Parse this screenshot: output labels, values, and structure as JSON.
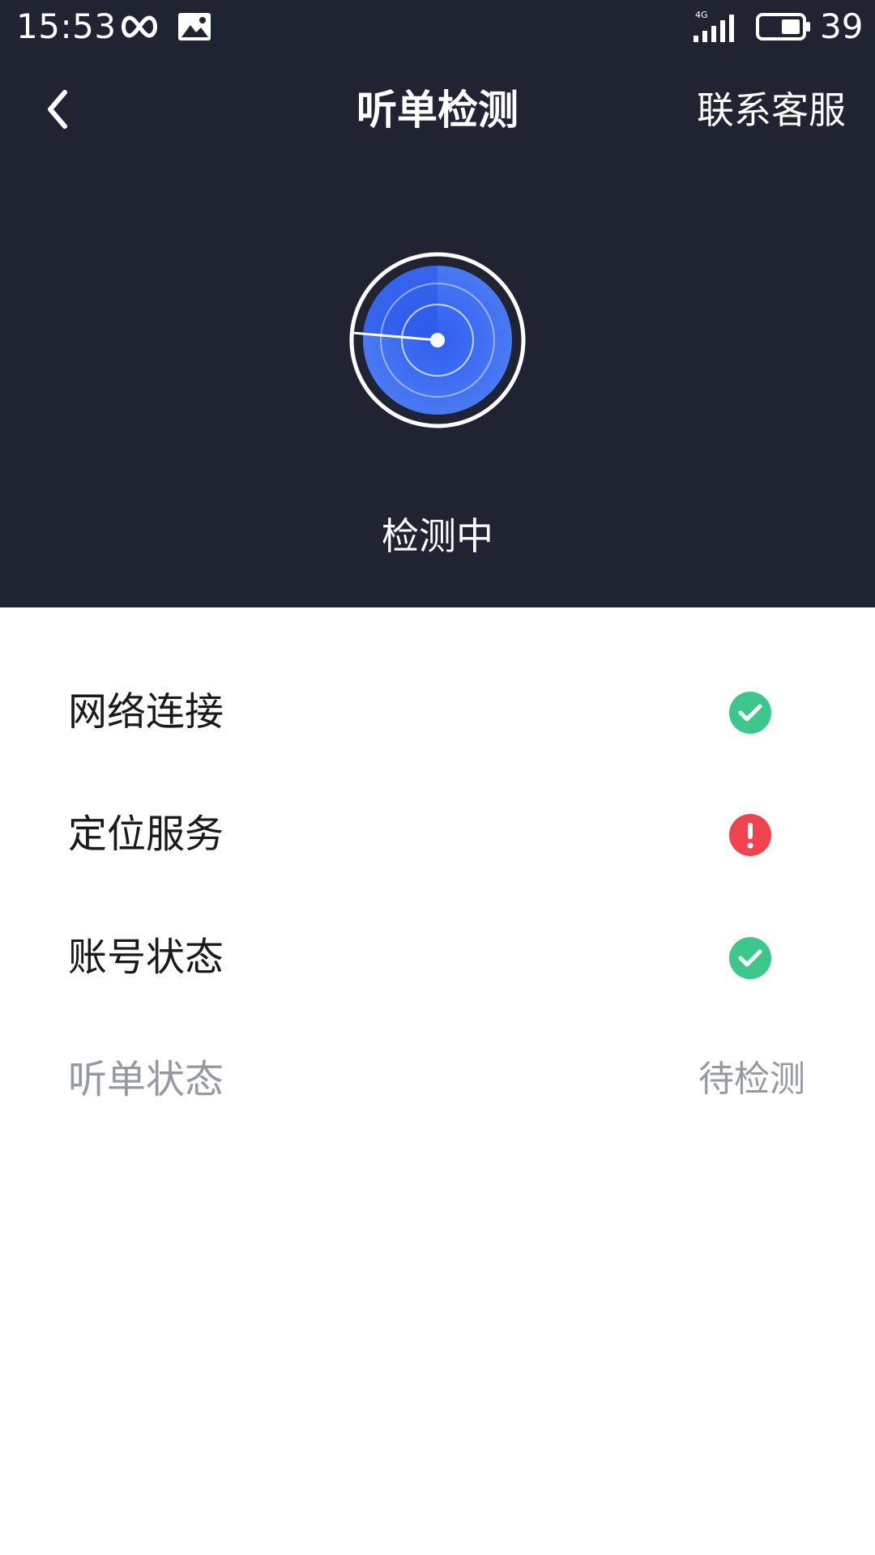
{
  "status_bar": {
    "time": "15:53",
    "network": "4G",
    "battery": "39",
    "icons": [
      "infinity-icon",
      "photo-icon",
      "signal-icon",
      "battery-icon"
    ]
  },
  "nav": {
    "back_icon": "chevron-left-icon",
    "title": "听单检测",
    "contact_label": "联系客服"
  },
  "radar": {
    "icon": "radar-icon",
    "status_text": "检测中"
  },
  "checks": [
    {
      "label": "网络连接",
      "state": "ok",
      "icon": "check-circle-icon"
    },
    {
      "label": "定位服务",
      "state": "error",
      "icon": "error-circle-icon"
    },
    {
      "label": "账号状态",
      "state": "ok",
      "icon": "check-circle-icon"
    },
    {
      "label": "听单状态",
      "state": "pending",
      "value": "待检测"
    }
  ],
  "colors": {
    "header_bg": "#202432",
    "radar_blue": "#3b6af0",
    "ok_green": "#3ec78a",
    "error_red": "#f0424f",
    "pending_gray": "#9599a4"
  }
}
